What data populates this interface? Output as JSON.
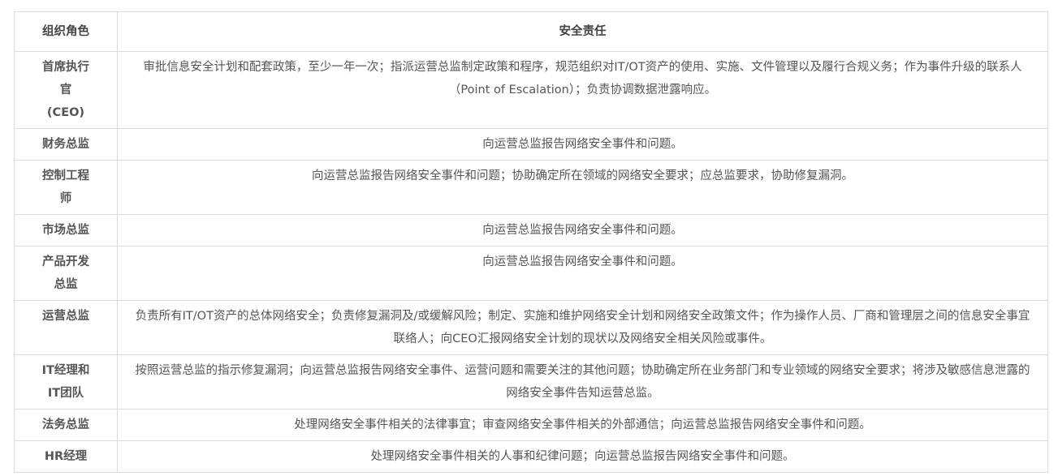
{
  "table": {
    "headers": [
      "组织角色",
      "安全责任"
    ],
    "rows": [
      {
        "role": "首席执行官\n(CEO)",
        "duty": "审批信息安全计划和配套政策，至少一年一次；指派运营总监制定政策和程序，规范组织对IT/OT资产的使用、实施、文件管理以及履行合规义务；作为事件升级的联系人（Point of Escalation）；负责协调数据泄露响应。"
      },
      {
        "role": "财务总监",
        "duty": "向运营总监报告网络安全事件和问题。"
      },
      {
        "role": "控制工程师",
        "duty": "向运营总监报告网络安全事件和问题；协助确定所在领域的网络安全要求；应总监要求，协助修复漏洞。"
      },
      {
        "role": "市场总监",
        "duty": "向运营总监报告网络安全事件和问题。"
      },
      {
        "role": "产品开发总监",
        "duty": "向运营总监报告网络安全事件和问题。"
      },
      {
        "role": "运营总监",
        "duty": "负责所有IT/OT资产的总体网络安全；负责修复漏洞及/或缓解风险；制定、实施和维护网络安全计划和网络安全政策文件；作为操作人员、厂商和管理层之间的信息安全事宜联络人；向CEO汇报网络安全计划的现状以及网络安全相关风险或事件。"
      },
      {
        "role": "IT经理和IT团队",
        "duty": "按照运营总监的指示修复漏洞；向运营总监报告网络安全事件、运营问题和需要关注的其他问题；协助确定所在业务部门和专业领域的网络安全要求；将涉及敏感信息泄露的网络安全事件告知运营总监。"
      },
      {
        "role": "法务总监",
        "duty": "处理网络安全事件相关的法律事宜；审查网络安全事件相关的外部通信；向运营总监报告网络安全事件和问题。"
      },
      {
        "role": "HR经理",
        "duty": "处理网络安全事件相关的人事和纪律问题；向运营总监报告网络安全事件和问题。"
      }
    ]
  }
}
